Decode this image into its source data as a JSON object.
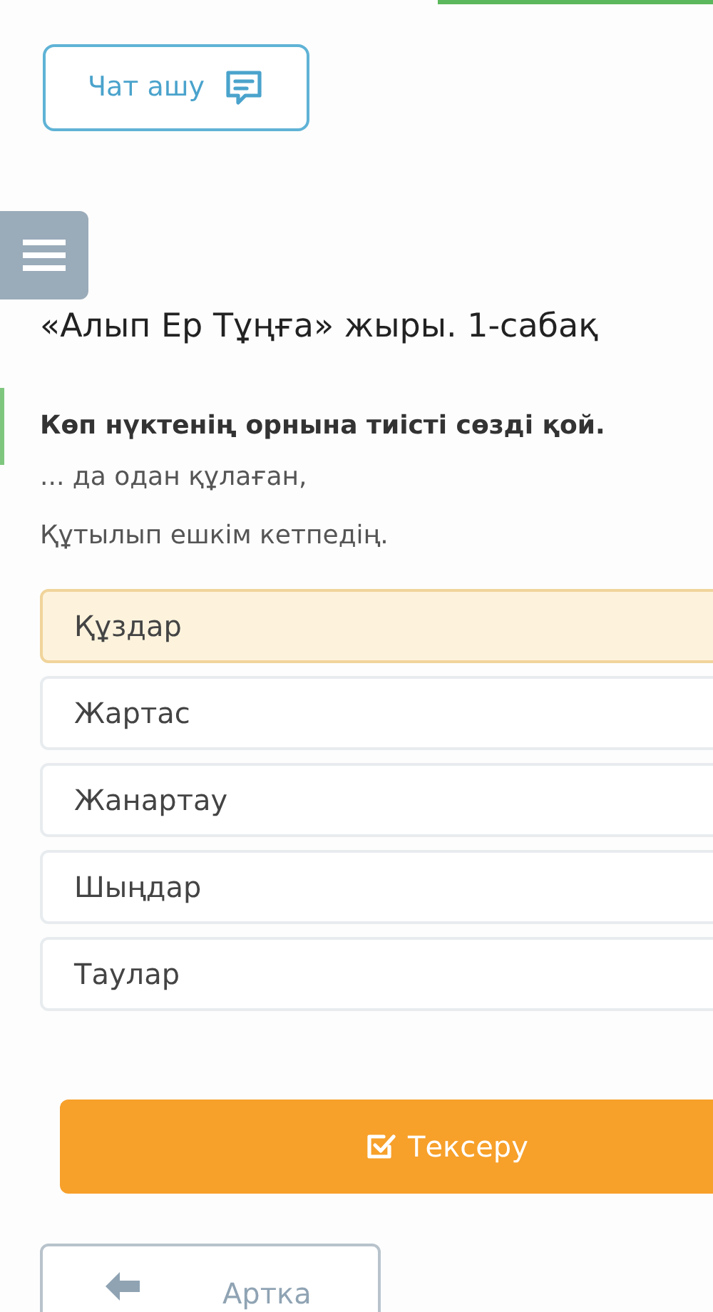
{
  "chat_button": {
    "label": "Чат ашу"
  },
  "lesson_title": "«Алып Ер Тұңға» жыры. 1-сабақ",
  "question": {
    "prompt": "Көп нүктенің орнына тиісті сөзді қой.",
    "lines": [
      "... да одан құлаған,",
      "Құтылып ешкім кетпедің."
    ]
  },
  "options": [
    {
      "label": "Құздар",
      "selected": true
    },
    {
      "label": "Жартас",
      "selected": false
    },
    {
      "label": "Жанартау",
      "selected": false
    },
    {
      "label": "Шыңдар",
      "selected": false
    },
    {
      "label": "Таулар",
      "selected": false
    }
  ],
  "check_button": {
    "label": "Тексеру"
  },
  "back_button": {
    "label": "Артка"
  }
}
